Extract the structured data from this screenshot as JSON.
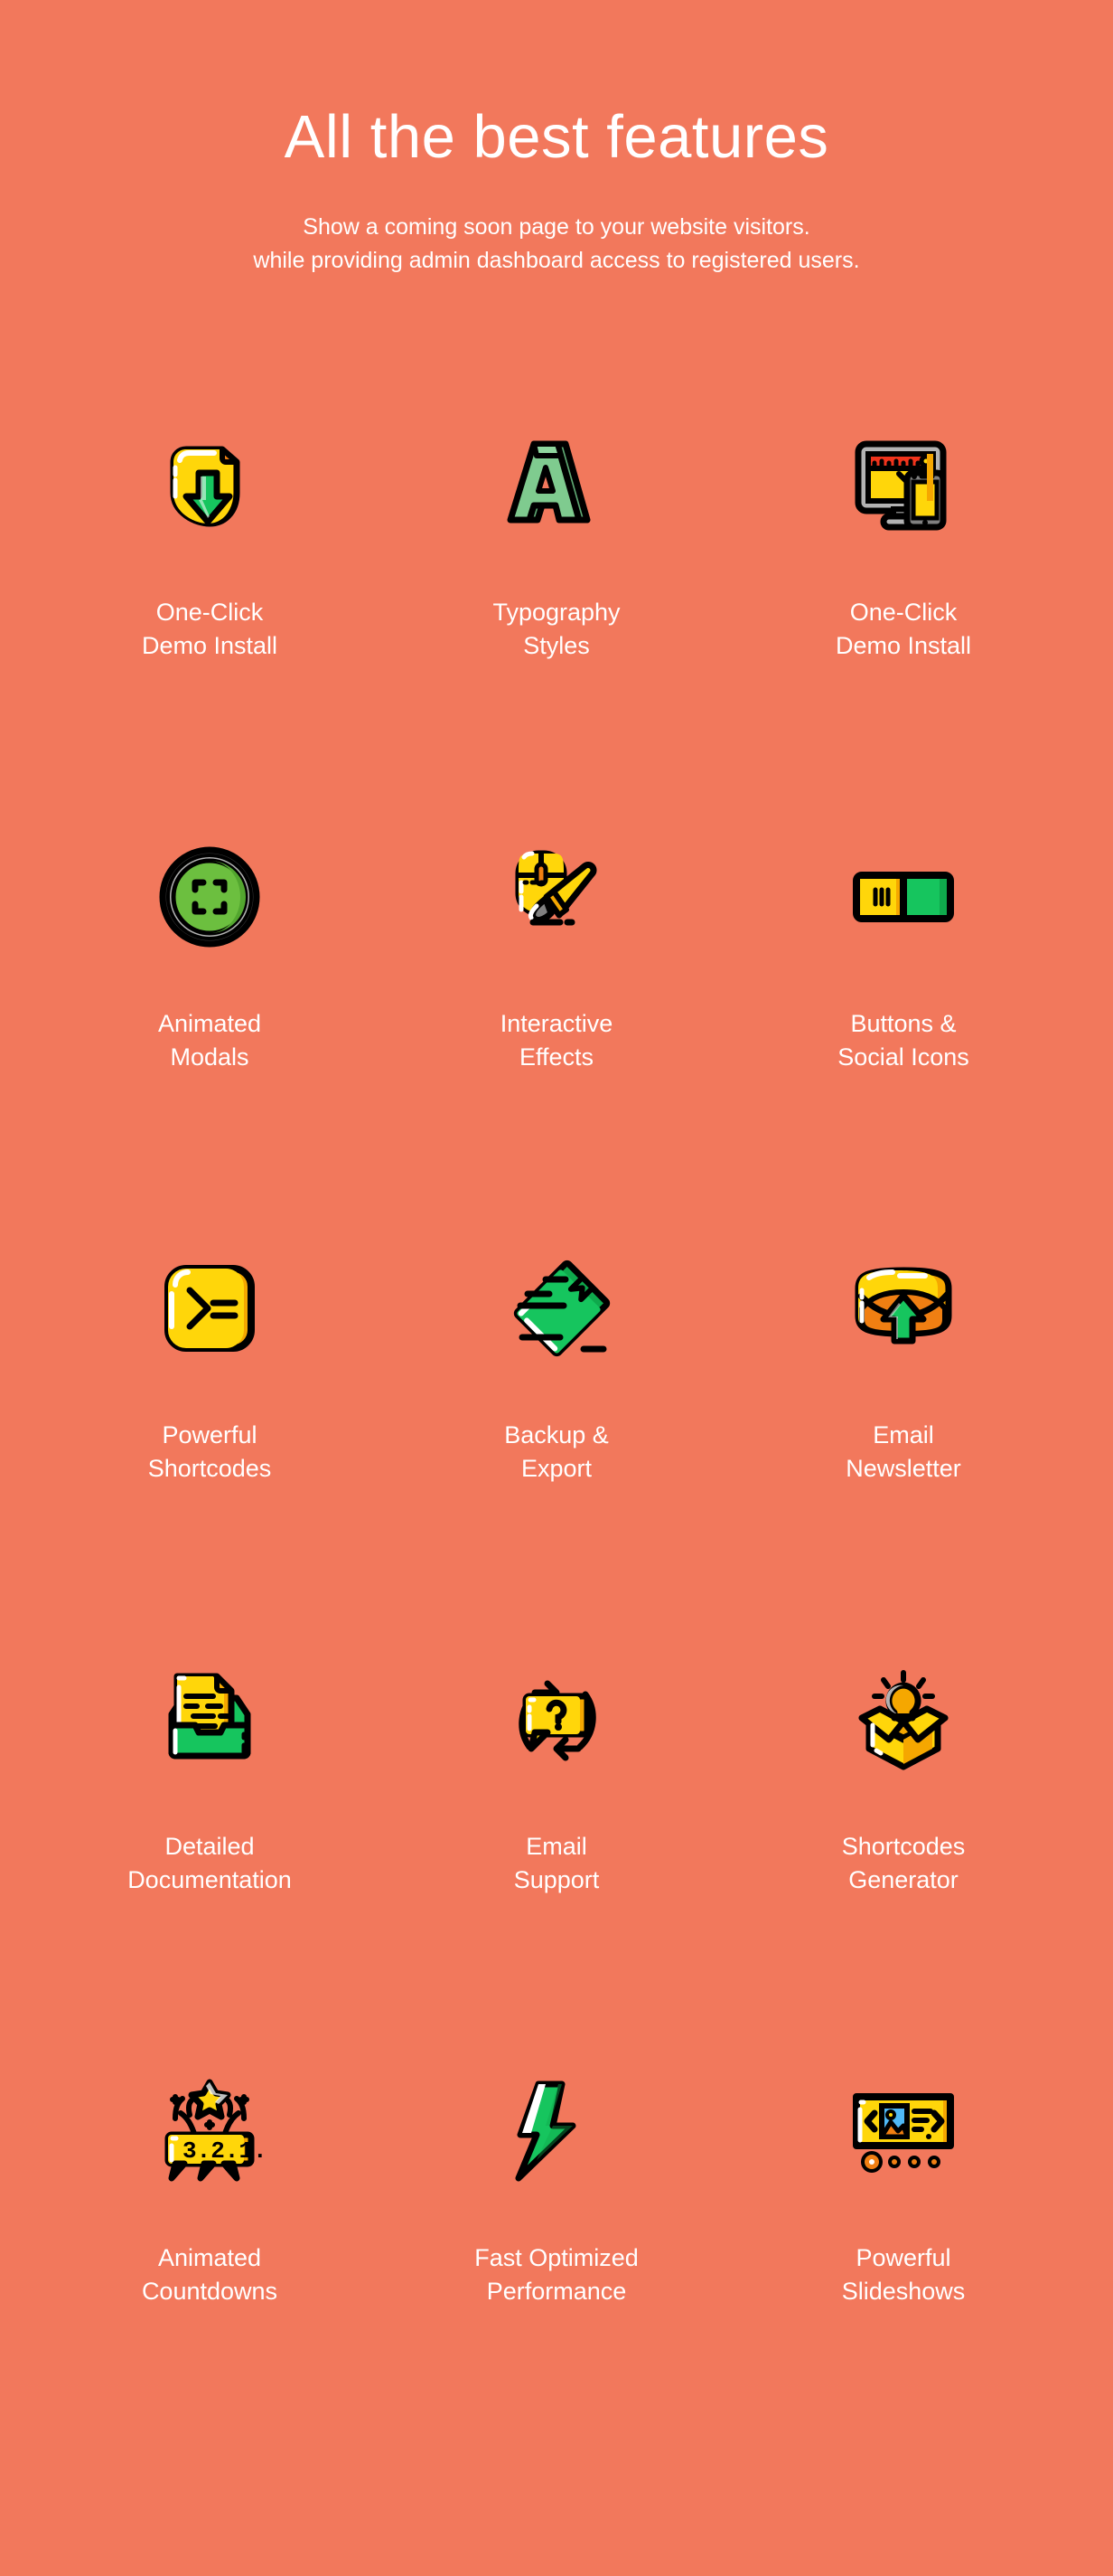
{
  "header": {
    "title": "All the best features",
    "subtitle_line1": "Show a coming soon page to your website visitors.",
    "subtitle_line2": "while providing admin dashboard access to registered users."
  },
  "colors": {
    "background": "#F2785C",
    "text": "#FFFFFF",
    "yellow": "#FFD60A",
    "yellow_dark": "#F5A700",
    "green": "#16C55E",
    "green_dark": "#0FA94C",
    "green_light": "#7FCB8F",
    "green_light_dark": "#5FA873",
    "grey": "#B3B3B3",
    "grey_dark": "#808080",
    "orange": "#F07F12",
    "red": "#F0341C",
    "blue": "#4FB8F5",
    "outline": "#000000"
  },
  "features": [
    {
      "id": 1,
      "icon": "download-folder-icon",
      "label": "One-Click\nDemo Install"
    },
    {
      "id": 2,
      "icon": "letter-a-3d-icon",
      "label": "Typography\nStyles"
    },
    {
      "id": 3,
      "icon": "responsive-devices-icon",
      "label": "One-Click\nDemo Install"
    },
    {
      "id": 4,
      "icon": "expand-button-icon",
      "label": "Animated\nModals"
    },
    {
      "id": 5,
      "icon": "mouse-paintbrush-icon",
      "label": "Interactive\nEffects"
    },
    {
      "id": 6,
      "icon": "toggle-buttons-icon",
      "label": "Buttons &\nSocial Icons"
    },
    {
      "id": 7,
      "icon": "terminal-prompt-icon",
      "label": "Powerful\nShortcodes"
    },
    {
      "id": 8,
      "icon": "flying-folder-icon",
      "label": "Backup &\nExport"
    },
    {
      "id": 9,
      "icon": "envelope-upload-icon",
      "label": "Email\nNewsletter"
    },
    {
      "id": 10,
      "icon": "document-tray-icon",
      "label": "Detailed\nDocumentation"
    },
    {
      "id": 11,
      "icon": "question-bubble-cycle-icon",
      "label": "Email\nSupport"
    },
    {
      "id": 12,
      "icon": "box-lightbulb-icon",
      "label": "Shortcodes\nGenerator"
    },
    {
      "id": 13,
      "icon": "countdown-banner-icon",
      "label": "Animated\nCountdowns"
    },
    {
      "id": 14,
      "icon": "lightning-bolt-icon",
      "label": "Fast Optimized\nPerformance"
    },
    {
      "id": 15,
      "icon": "slideshow-carousel-icon",
      "label": "Powerful\nSlideshows"
    }
  ],
  "icon_texts": {
    "letter_a": "A",
    "terminal_prompt": ">=",
    "countdown": "3.2.1...",
    "question_mark": "?"
  }
}
